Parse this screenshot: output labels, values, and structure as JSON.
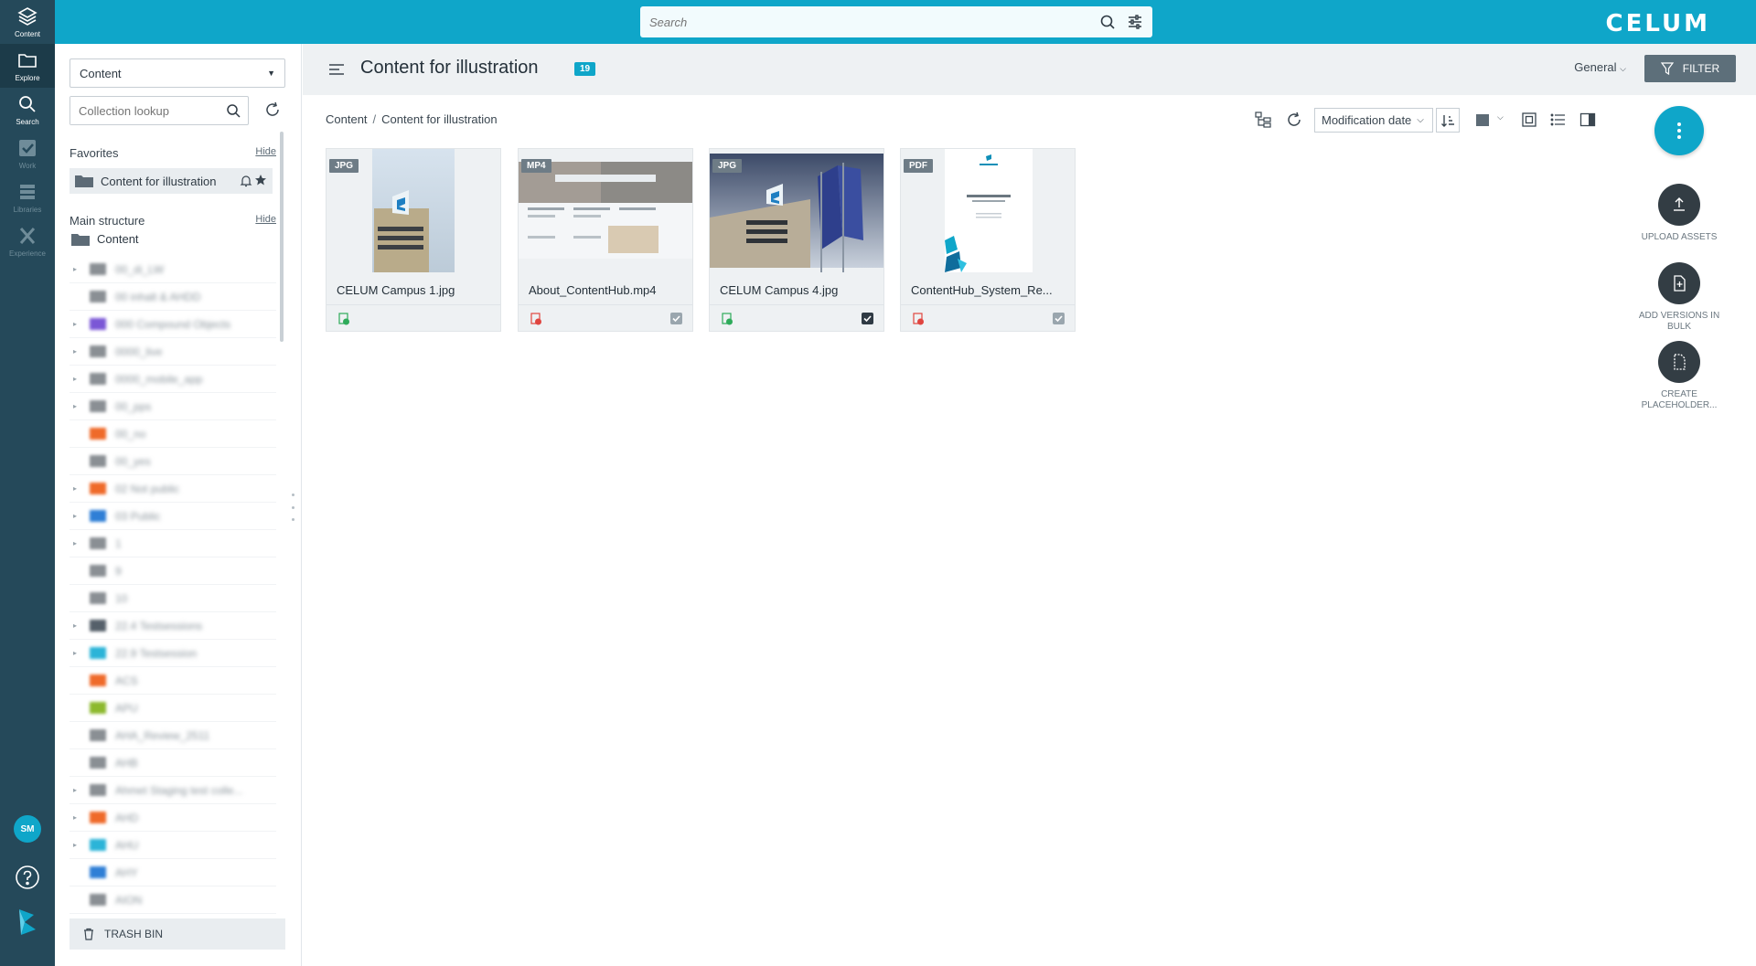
{
  "rail": {
    "items": [
      {
        "label": "Content",
        "icon": "layers-icon"
      },
      {
        "label": "Explore",
        "icon": "folder-icon"
      },
      {
        "label": "Search",
        "icon": "search-icon"
      },
      {
        "label": "Work",
        "icon": "check-icon"
      },
      {
        "label": "Libraries",
        "icon": "stack-icon"
      },
      {
        "label": "Experience",
        "icon": "x-icon"
      }
    ],
    "avatar": "SM"
  },
  "topbar": {
    "search_placeholder": "Search",
    "brand": "CELUM"
  },
  "sidebar": {
    "select_value": "Content",
    "lookup_placeholder": "Collection lookup",
    "favorites_title": "Favorites",
    "hide_label": "Hide",
    "favorite_item": "Content for illustration",
    "main_title": "Main structure",
    "root_item": "Content",
    "tree": [
      {
        "label": "00_di_LW",
        "color": "#8a8f94",
        "caret": true
      },
      {
        "label": "00 inhalt & AHDD",
        "color": "#8a8f94",
        "caret": false
      },
      {
        "label": "000 Compound Objects",
        "color": "#7b57d6",
        "caret": true
      },
      {
        "label": "0000_live",
        "color": "#8a8f94",
        "caret": true
      },
      {
        "label": "0000_mobile_app",
        "color": "#8a8f94",
        "caret": true
      },
      {
        "label": "00_pps",
        "color": "#8a8f94",
        "caret": true
      },
      {
        "label": "00_no",
        "color": "#ef6a2a",
        "caret": false
      },
      {
        "label": "00_yes",
        "color": "#8a8f94",
        "caret": false
      },
      {
        "label": "02 Not public",
        "color": "#ef6a2a",
        "caret": true
      },
      {
        "label": "03 Public",
        "color": "#2f7fd6",
        "caret": true
      },
      {
        "label": "1",
        "color": "#8a8f94",
        "caret": true
      },
      {
        "label": "9",
        "color": "#8a8f94",
        "caret": false
      },
      {
        "label": "10",
        "color": "#8a8f94",
        "caret": false
      },
      {
        "label": "22.4 Testsessions",
        "color": "#55606a",
        "caret": true
      },
      {
        "label": "22.9 Testsession",
        "color": "#2bb4d8",
        "caret": true
      },
      {
        "label": "ACS",
        "color": "#ef6a2a",
        "caret": false
      },
      {
        "label": "APU",
        "color": "#8db92e",
        "caret": false
      },
      {
        "label": "AHA_Review_2511",
        "color": "#8a8f94",
        "caret": false
      },
      {
        "label": "AHB",
        "color": "#8a8f94",
        "caret": false
      },
      {
        "label": "Ahmet Staging test colle...",
        "color": "#8a8f94",
        "caret": true
      },
      {
        "label": "AHD",
        "color": "#ef6a2a",
        "caret": true
      },
      {
        "label": "AHU",
        "color": "#2bb4d8",
        "caret": true
      },
      {
        "label": "AHY",
        "color": "#2f7fd6",
        "caret": false
      },
      {
        "label": "AION",
        "color": "#8a8f94",
        "caret": false
      }
    ],
    "trash": "TRASH BIN"
  },
  "main": {
    "title": "Content for illustration",
    "count": "19",
    "general": "General",
    "filter": "FILTER",
    "breadcrumb": [
      "Content",
      "Content for illustration"
    ],
    "sort": "Modification date"
  },
  "assets": [
    {
      "type": "JPG",
      "name": "CELUM Campus 1.jpg",
      "status": "green",
      "checked": false
    },
    {
      "type": "MP4",
      "name": "About_ContentHub.mp4",
      "status": "red",
      "checked": true
    },
    {
      "type": "JPG",
      "name": "CELUM Campus 4.jpg",
      "status": "green",
      "checked": true
    },
    {
      "type": "PDF",
      "name": "ContentHub_System_Re...",
      "status": "red",
      "checked": true
    }
  ],
  "actions": {
    "upload": "UPLOAD ASSETS",
    "versions": "ADD VERSIONS IN BULK",
    "placeholder": "CREATE PLACEHOLDER..."
  },
  "colors": {
    "accent": "#0fa6c9",
    "rail": "#25495a"
  }
}
